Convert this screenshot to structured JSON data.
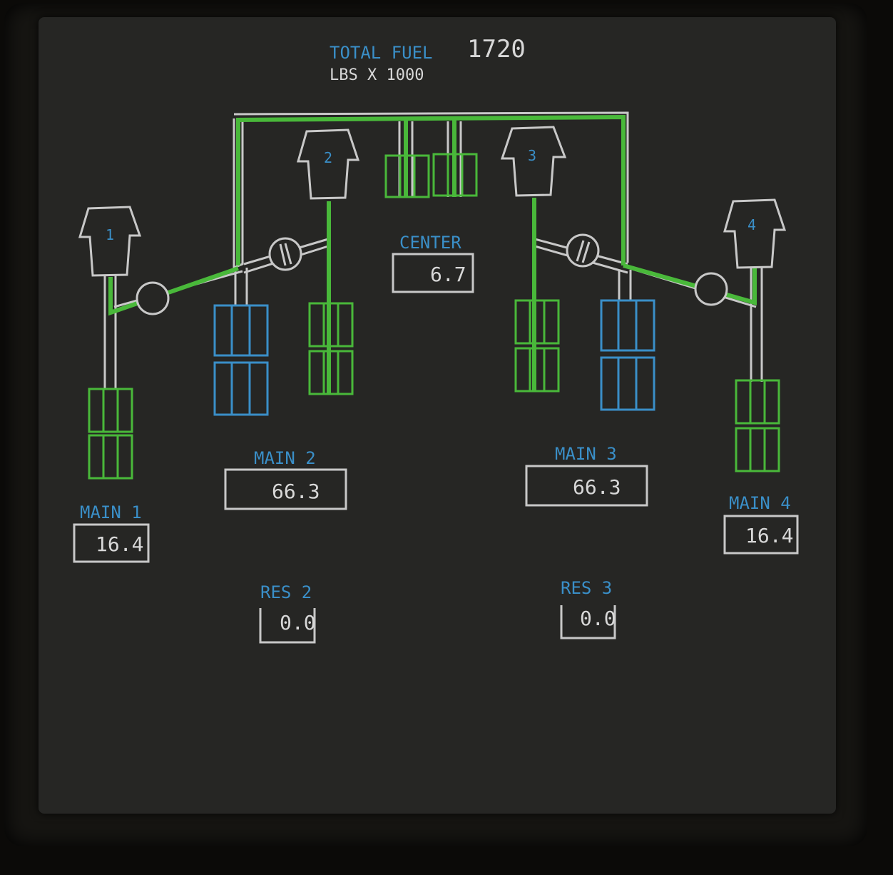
{
  "header": {
    "total_fuel_label": "TOTAL FUEL",
    "total_fuel_value": "1720",
    "units_label": "LBS X 1000"
  },
  "engines": [
    {
      "label": "1"
    },
    {
      "label": "2"
    },
    {
      "label": "3"
    },
    {
      "label": "4"
    }
  ],
  "tanks": {
    "center": {
      "label": "CENTER",
      "value": "6.7"
    },
    "main1": {
      "label": "MAIN 1",
      "value": "16.4"
    },
    "main2": {
      "label": "MAIN 2",
      "value": "66.3"
    },
    "main3": {
      "label": "MAIN 3",
      "value": "66.3"
    },
    "main4": {
      "label": "MAIN 4",
      "value": "16.4"
    },
    "res2": {
      "label": "RES 2",
      "value": "0.0"
    },
    "res3": {
      "label": "RES 3",
      "value": "0.0"
    }
  },
  "colors": {
    "active_flow": "#49b83a",
    "inactive_line": "#c8c8c8",
    "label_blue": "#3a8fc8",
    "pump_off_blue": "#3a8fc8"
  }
}
